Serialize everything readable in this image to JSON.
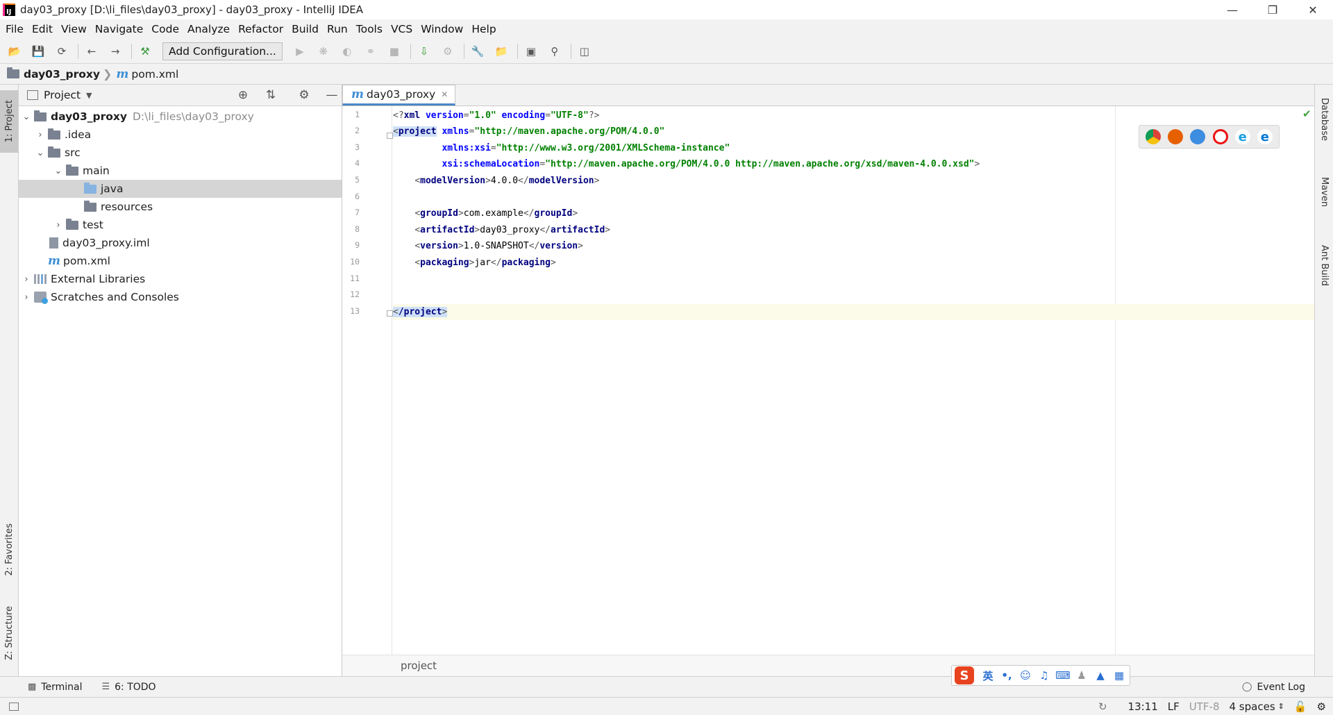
{
  "window": {
    "title": "day03_proxy [D:\\li_files\\day03_proxy] - day03_proxy - IntelliJ IDEA",
    "controls": [
      "minimize",
      "restore",
      "close"
    ]
  },
  "menu": [
    "File",
    "Edit",
    "View",
    "Navigate",
    "Code",
    "Analyze",
    "Refactor",
    "Build",
    "Run",
    "Tools",
    "VCS",
    "Window",
    "Help"
  ],
  "toolbar": {
    "run_config_label": "Add Configuration..."
  },
  "breadcrumb": {
    "project": "day03_proxy",
    "file": "pom.xml"
  },
  "left_stripe": {
    "project_tab": "1: Project",
    "favorites_tab": "2: Favorites",
    "structure_tab": "Z: Structure"
  },
  "right_stripe": {
    "database_tab": "Database",
    "maven_tab": "Maven",
    "ant_tab": "Ant Build"
  },
  "project_panel": {
    "header": "Project",
    "tree": {
      "root_name": "day03_proxy",
      "root_path": "D:\\li_files\\day03_proxy",
      "idea": ".idea",
      "src": "src",
      "main": "main",
      "java": "java",
      "resources": "resources",
      "test": "test",
      "iml": "day03_proxy.iml",
      "pom": "pom.xml",
      "external_libraries": "External Libraries",
      "scratches": "Scratches and Consoles"
    }
  },
  "editor": {
    "tab_label": "day03_proxy",
    "line_numbers": [
      "1",
      "2",
      "3",
      "4",
      "5",
      "6",
      "7",
      "8",
      "9",
      "10",
      "11",
      "12",
      "13"
    ],
    "code": {
      "l1_open": "<?",
      "l1_tag": "xml",
      "l1_a1": " version",
      "l1_v1": "\"1.0\"",
      "l1_a2": " encoding",
      "l1_v2": "\"UTF-8\"",
      "l1_close": "?>",
      "l2_tag": "project",
      "l2_attr": "xmlns",
      "l2_val": "\"http://maven.apache.org/POM/4.0.0\"",
      "l3_attr": "xmlns:xsi",
      "l3_val": "\"http://www.w3.org/2001/XMLSchema-instance\"",
      "l4_attr": "xsi:schemaLocation",
      "l4_val": "\"http://maven.apache.org/POM/4.0.0 http://maven.apache.org/xsd/maven-4.0.0.xsd\"",
      "l5_tag": "modelVersion",
      "l5_text": "4.0.0",
      "l7_tag": "groupId",
      "l7_text": "com.example",
      "l8_tag": "artifactId",
      "l8_text": "day03_proxy",
      "l9_tag": "version",
      "l9_text": "1.0-SNAPSHOT",
      "l10_tag": "packaging",
      "l10_text": "jar",
      "l13_tag": "/project"
    },
    "bottom_breadcrumb": "project",
    "browsers": [
      "chrome",
      "firefox",
      "safari",
      "opera",
      "internet-explorer",
      "edge"
    ]
  },
  "bottom_tools": {
    "terminal": "Terminal",
    "todo": "6: TODO",
    "event_log": "Event Log"
  },
  "ime": {
    "logo": "S",
    "mode": "英",
    "punct": "•,"
  },
  "statusbar": {
    "position": "13:11",
    "line_sep": "LF",
    "encoding": "UTF-8",
    "indent": "4 spaces"
  }
}
